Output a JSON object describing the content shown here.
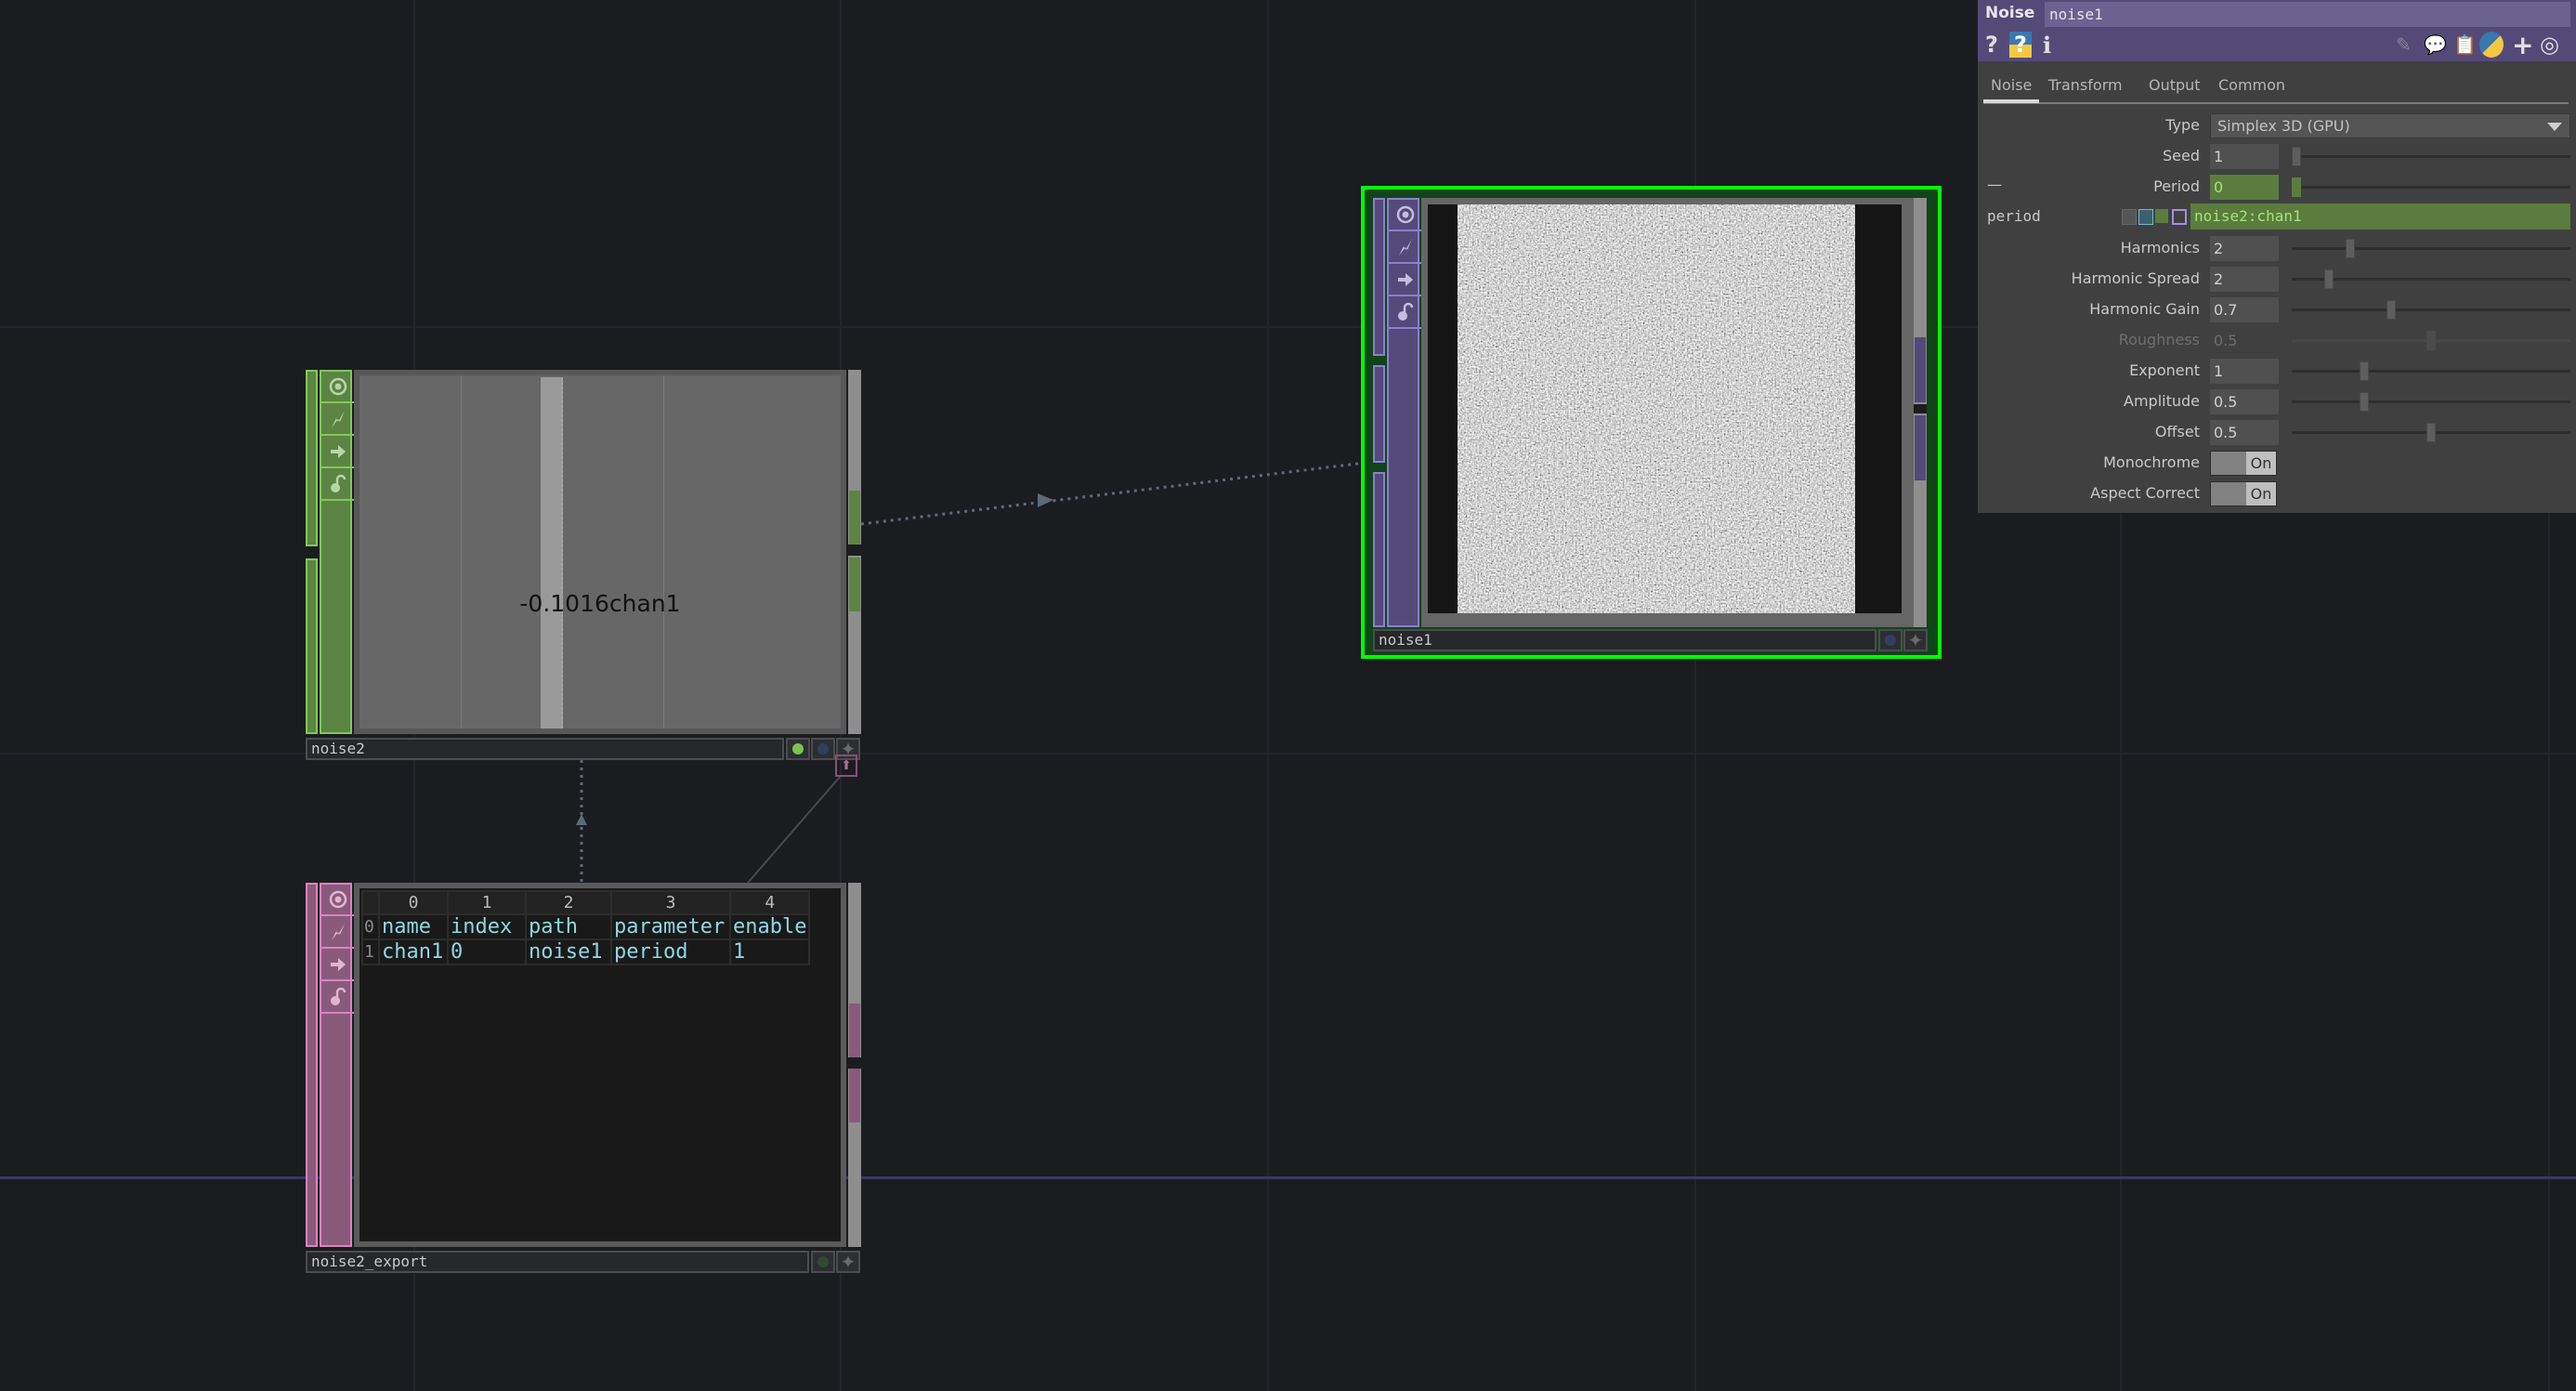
{
  "network": {
    "connection_arrow_icon": "triangle-arrow",
    "export_link_icon": "export-arrow-icon"
  },
  "nodes": {
    "noise2": {
      "name": "noise2",
      "family": "CHOP",
      "color": "#5c8443",
      "viewer_text": "-0.1016chan1",
      "side_icons": [
        "viewer-toggle-icon",
        "cook-icon",
        "bypass-icon",
        "lock-icon"
      ],
      "footer_flags": [
        "display-flag",
        "render-flag",
        "add-icon"
      ]
    },
    "noise2_export": {
      "name": "noise2_export",
      "family": "DAT",
      "color": "#8a5a7c",
      "table": {
        "col_indices": [
          "0",
          "1",
          "2",
          "3",
          "4"
        ],
        "rows": [
          {
            "index": "0",
            "cells": [
              "name",
              "index",
              "path",
              "parameter",
              "enable"
            ]
          },
          {
            "index": "1",
            "cells": [
              "chan1",
              "0",
              "noise1",
              "period",
              "1"
            ]
          }
        ]
      }
    },
    "noise1": {
      "name": "noise1",
      "family": "TOP",
      "color": "#544a7a",
      "selected": true,
      "selection_color": "#00ff00",
      "viewer_content": "monochrome noise image"
    }
  },
  "param_panel": {
    "op_type": "Noise",
    "op_name": "noise1",
    "header_icons": [
      "help-icon",
      "python-help-icon",
      "info-icon",
      "edit-icon",
      "comment-icon",
      "clipboard-icon",
      "python-icon",
      "add-icon",
      "target-icon"
    ],
    "tabs": [
      {
        "label": "Noise",
        "active": true
      },
      {
        "label": "Transform",
        "active": false
      },
      {
        "label": "Output",
        "active": false
      },
      {
        "label": "Common",
        "active": false
      }
    ],
    "type": {
      "label": "Type",
      "value": "Simplex 3D (GPU)"
    },
    "seed": {
      "label": "Seed",
      "value": "1",
      "slider_fraction": 0.0
    },
    "period": {
      "label": "Period",
      "value": "0",
      "slider_fraction": 0.0,
      "collapse_symbol": "—"
    },
    "period_expr": {
      "param_name": "period",
      "expression": "noise2:chan1"
    },
    "harmonics": {
      "label": "Harmonics",
      "value": "2",
      "slider_fraction": 0.2
    },
    "harmonic_spread": {
      "label": "Harmonic Spread",
      "value": "2",
      "slider_fraction": 0.12
    },
    "harmonic_gain": {
      "label": "Harmonic Gain",
      "value": "0.7",
      "slider_fraction": 0.35
    },
    "roughness": {
      "label": "Roughness",
      "value": "0.5",
      "slider_fraction": 0.5,
      "disabled": true
    },
    "exponent": {
      "label": "Exponent",
      "value": "1",
      "slider_fraction": 0.25
    },
    "amplitude": {
      "label": "Amplitude",
      "value": "0.5",
      "slider_fraction": 0.25
    },
    "offset": {
      "label": "Offset",
      "value": "0.5",
      "slider_fraction": 0.5
    },
    "monochrome": {
      "label": "Monochrome",
      "value": "On"
    },
    "aspect_correct": {
      "label": "Aspect Correct",
      "value": "On"
    }
  }
}
